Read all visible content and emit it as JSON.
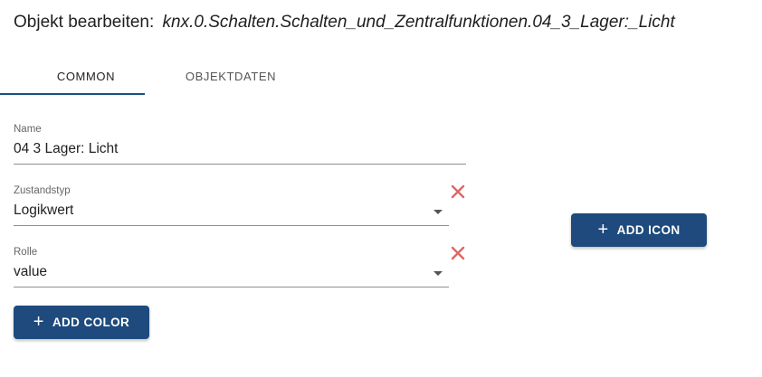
{
  "header": {
    "prefix": "Objekt bearbeiten:",
    "object_id": "knx.0.Schalten.Schalten_und_Zentralfunktionen.04_3_Lager:_Licht"
  },
  "tabs": [
    {
      "label": "COMMON",
      "active": true
    },
    {
      "label": "OBJEKTDATEN",
      "active": false
    }
  ],
  "fields": {
    "name": {
      "label": "Name",
      "value": "04 3 Lager: Licht"
    },
    "zustandstyp": {
      "label": "Zustandstyp",
      "value": "Logikwert"
    },
    "rolle": {
      "label": "Rolle",
      "value": "value"
    }
  },
  "buttons": {
    "add_icon": "ADD ICON",
    "add_color": "ADD COLOR",
    "plus_glyph": "+"
  },
  "colors": {
    "accent": "#1e4a7d",
    "clear_icon": "#e06666",
    "tab_indicator": "#1e4d80"
  },
  "icons": {
    "clear": "close-icon",
    "dropdown": "chevron-down-icon",
    "add": "plus-icon"
  }
}
